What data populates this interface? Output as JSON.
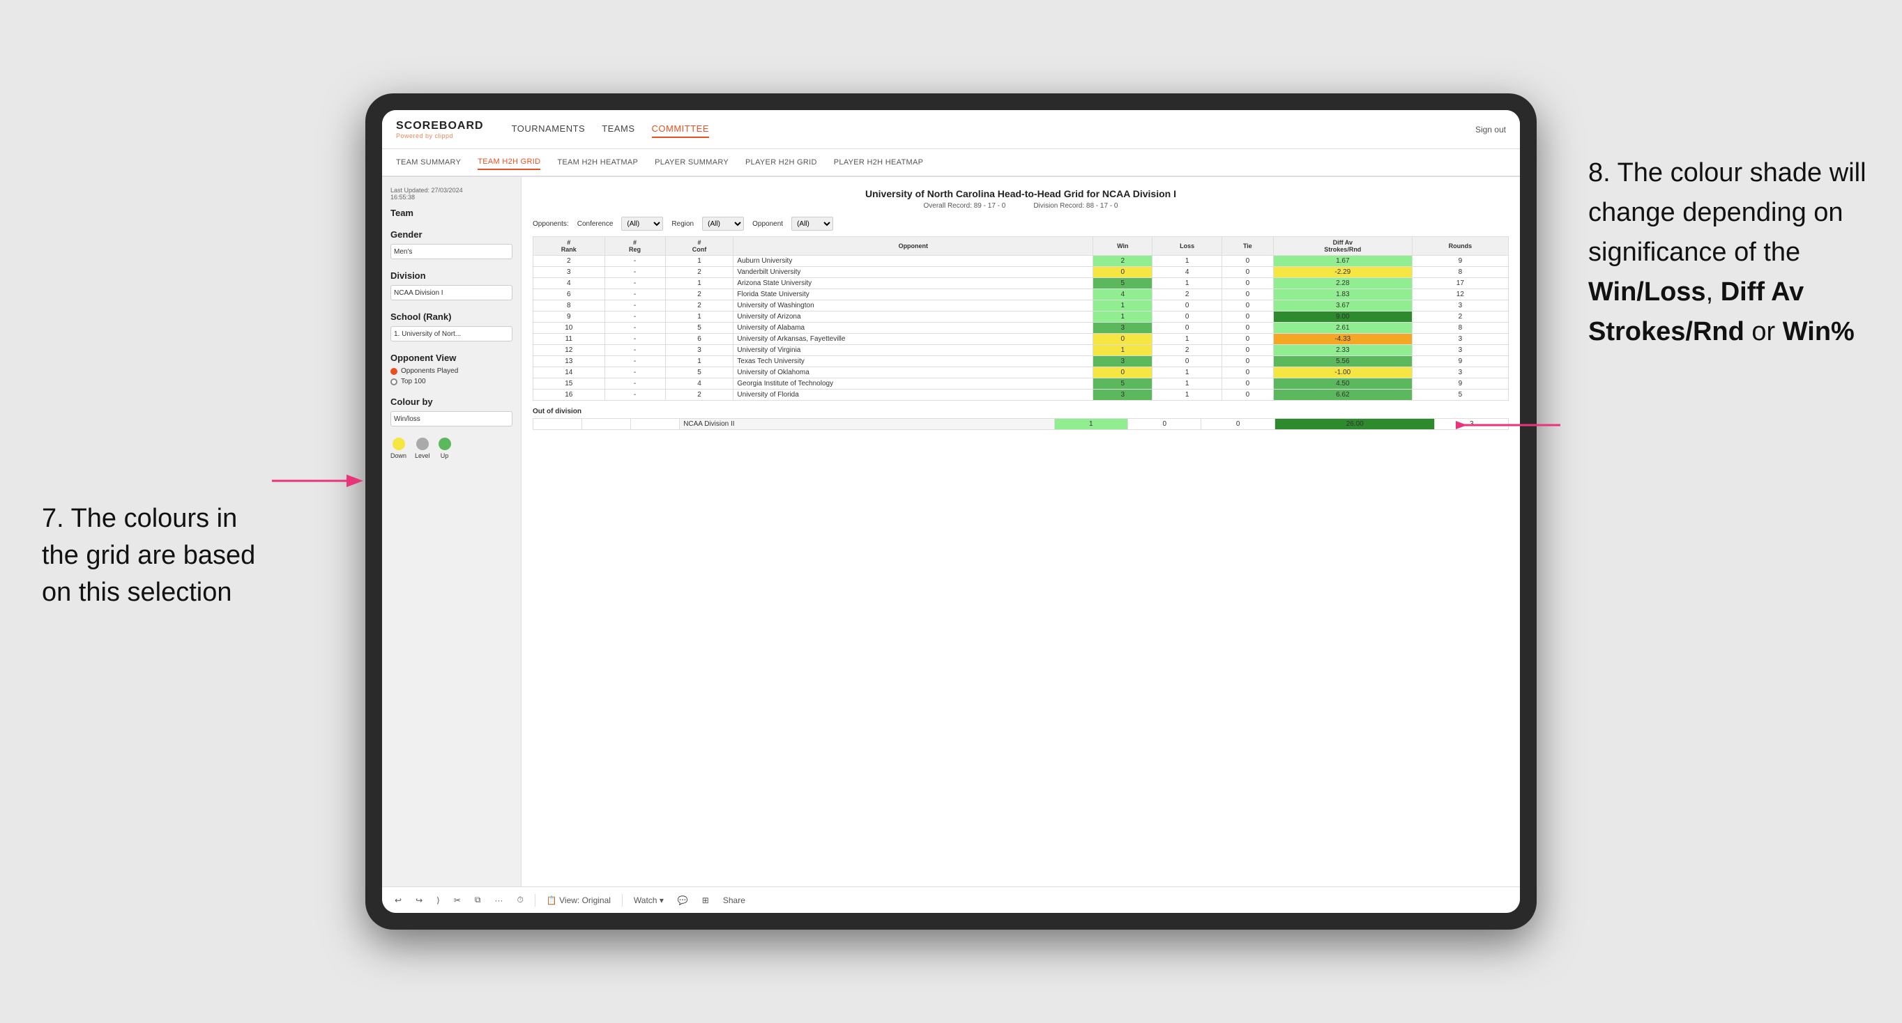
{
  "annotations": {
    "left_heading": "7. The colours in the grid are based on this selection",
    "right_heading": "8. The colour shade will change depending on significance of the ",
    "right_bold1": "Win/Loss",
    "right_sep1": ", ",
    "right_bold2": "Diff Av Strokes/Rnd",
    "right_sep2": " or ",
    "right_bold3": "Win%"
  },
  "navbar": {
    "logo": "SCOREBOARD",
    "logo_sub": "Powered by clippd",
    "nav_items": [
      "TOURNAMENTS",
      "TEAMS",
      "COMMITTEE"
    ],
    "sign_out": "Sign out"
  },
  "sub_tabs": [
    "TEAM SUMMARY",
    "TEAM H2H GRID",
    "TEAM H2H HEATMAP",
    "PLAYER SUMMARY",
    "PLAYER H2H GRID",
    "PLAYER H2H HEATMAP"
  ],
  "active_sub_tab": "TEAM H2H GRID",
  "left_panel": {
    "update_label": "Last Updated: 27/03/2024",
    "update_time": "16:55:38",
    "team_label": "Team",
    "gender_label": "Gender",
    "gender_value": "Men's",
    "division_label": "Division",
    "division_value": "NCAA Division I",
    "school_label": "School (Rank)",
    "school_value": "1. University of Nort...",
    "opponent_view_label": "Opponent View",
    "opponent_option1": "Opponents Played",
    "opponent_option2": "Top 100",
    "colour_by_label": "Colour by",
    "colour_by_value": "Win/loss",
    "legend": {
      "down_label": "Down",
      "level_label": "Level",
      "up_label": "Up"
    }
  },
  "grid": {
    "title": "University of North Carolina Head-to-Head Grid for NCAA Division I",
    "overall_record": "Overall Record: 89 - 17 - 0",
    "division_record": "Division Record: 88 - 17 - 0",
    "conference_label": "Conference",
    "conference_value": "(All)",
    "region_label": "Region",
    "region_value": "(All)",
    "opponent_label": "Opponent",
    "opponent_value": "(All)",
    "opponents_label": "Opponents:",
    "columns": [
      "#\nRank",
      "#\nReg",
      "#\nConf",
      "Opponent",
      "Win",
      "Loss",
      "Tie",
      "Diff Av\nStrokes/Rnd",
      "Rounds"
    ],
    "rows": [
      {
        "rank": "2",
        "reg": "-",
        "conf": "1",
        "opponent": "Auburn University",
        "win": "2",
        "loss": "1",
        "tie": "0",
        "diff": "1.67",
        "rounds": "9",
        "win_color": "green-light",
        "loss_color": "white",
        "diff_color": "green-light"
      },
      {
        "rank": "3",
        "reg": "-",
        "conf": "2",
        "opponent": "Vanderbilt University",
        "win": "0",
        "loss": "4",
        "tie": "0",
        "diff": "-2.29",
        "rounds": "8",
        "win_color": "yellow",
        "loss_color": "white",
        "diff_color": "yellow"
      },
      {
        "rank": "4",
        "reg": "-",
        "conf": "1",
        "opponent": "Arizona State University",
        "win": "5",
        "loss": "1",
        "tie": "0",
        "diff": "2.28",
        "rounds": "17",
        "win_color": "green-med",
        "loss_color": "white",
        "diff_color": "green-light"
      },
      {
        "rank": "6",
        "reg": "-",
        "conf": "2",
        "opponent": "Florida State University",
        "win": "4",
        "loss": "2",
        "tie": "0",
        "diff": "1.83",
        "rounds": "12",
        "win_color": "green-light",
        "loss_color": "white",
        "diff_color": "green-light"
      },
      {
        "rank": "8",
        "reg": "-",
        "conf": "2",
        "opponent": "University of Washington",
        "win": "1",
        "loss": "0",
        "tie": "0",
        "diff": "3.67",
        "rounds": "3",
        "win_color": "green-light",
        "loss_color": "white",
        "diff_color": "green-light"
      },
      {
        "rank": "9",
        "reg": "-",
        "conf": "1",
        "opponent": "University of Arizona",
        "win": "1",
        "loss": "0",
        "tie": "0",
        "diff": "9.00",
        "rounds": "2",
        "win_color": "green-light",
        "loss_color": "white",
        "diff_color": "green-dark"
      },
      {
        "rank": "10",
        "reg": "-",
        "conf": "5",
        "opponent": "University of Alabama",
        "win": "3",
        "loss": "0",
        "tie": "0",
        "diff": "2.61",
        "rounds": "8",
        "win_color": "green-med",
        "loss_color": "white",
        "diff_color": "green-light"
      },
      {
        "rank": "11",
        "reg": "-",
        "conf": "6",
        "opponent": "University of Arkansas, Fayetteville",
        "win": "0",
        "loss": "1",
        "tie": "0",
        "diff": "-4.33",
        "rounds": "3",
        "win_color": "yellow",
        "loss_color": "white",
        "diff_color": "orange"
      },
      {
        "rank": "12",
        "reg": "-",
        "conf": "3",
        "opponent": "University of Virginia",
        "win": "1",
        "loss": "2",
        "tie": "0",
        "diff": "2.33",
        "rounds": "3",
        "win_color": "yellow",
        "loss_color": "white",
        "diff_color": "green-light"
      },
      {
        "rank": "13",
        "reg": "-",
        "conf": "1",
        "opponent": "Texas Tech University",
        "win": "3",
        "loss": "0",
        "tie": "0",
        "diff": "5.56",
        "rounds": "9",
        "win_color": "green-med",
        "loss_color": "white",
        "diff_color": "green-med"
      },
      {
        "rank": "14",
        "reg": "-",
        "conf": "5",
        "opponent": "University of Oklahoma",
        "win": "0",
        "loss": "1",
        "tie": "0",
        "diff": "-1.00",
        "rounds": "3",
        "win_color": "yellow",
        "loss_color": "white",
        "diff_color": "yellow"
      },
      {
        "rank": "15",
        "reg": "-",
        "conf": "4",
        "opponent": "Georgia Institute of Technology",
        "win": "5",
        "loss": "1",
        "tie": "0",
        "diff": "4.50",
        "rounds": "9",
        "win_color": "green-med",
        "loss_color": "white",
        "diff_color": "green-med"
      },
      {
        "rank": "16",
        "reg": "-",
        "conf": "2",
        "opponent": "University of Florida",
        "win": "3",
        "loss": "1",
        "tie": "0",
        "diff": "6.62",
        "rounds": "5",
        "win_color": "green-med",
        "loss_color": "white",
        "diff_color": "green-med"
      }
    ],
    "out_of_division_label": "Out of division",
    "out_of_division_row": {
      "division": "NCAA Division II",
      "win": "1",
      "loss": "0",
      "tie": "0",
      "diff": "26.00",
      "rounds": "3",
      "diff_color": "green-dark"
    }
  },
  "bottom_toolbar": {
    "view_label": "View: Original",
    "watch_label": "Watch ▾",
    "share_label": "Share"
  },
  "legend": {
    "down_color": "#f5e642",
    "level_color": "#aaa",
    "up_color": "#5cb85c"
  }
}
